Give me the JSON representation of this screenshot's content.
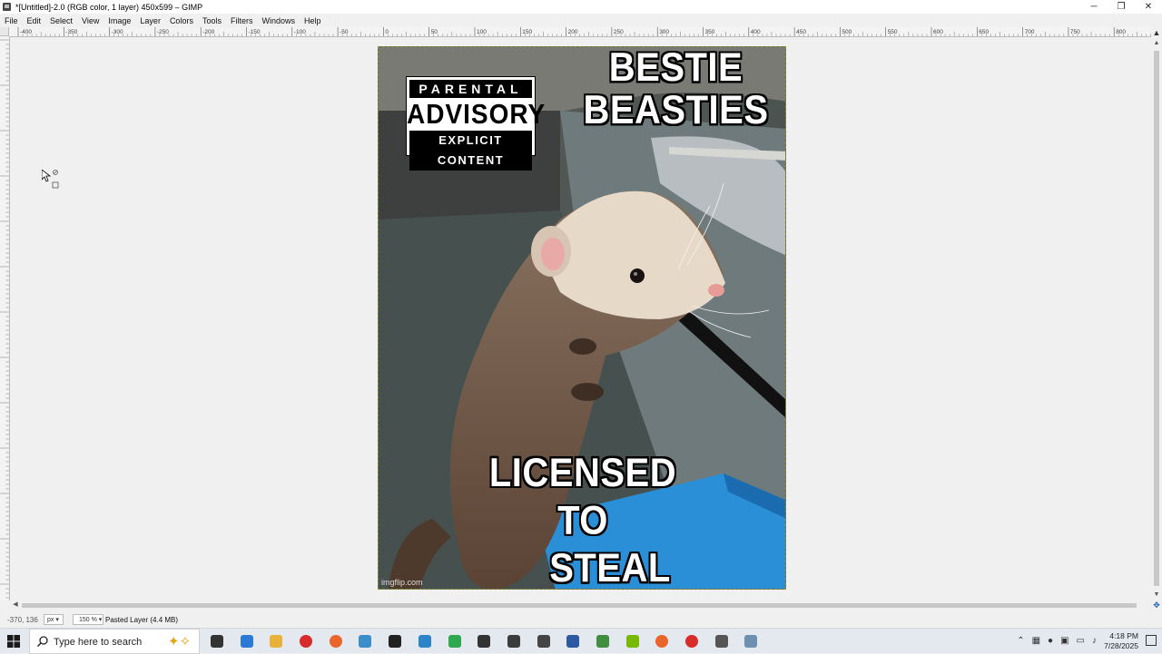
{
  "window": {
    "title": "*[Untitled]-2.0 (RGB color, 1 layer) 450x599 – GIMP",
    "controls": [
      "─",
      "❐",
      "✕"
    ]
  },
  "menu": [
    "File",
    "Edit",
    "Select",
    "View",
    "Image",
    "Layer",
    "Colors",
    "Tools",
    "Filters",
    "Windows",
    "Help"
  ],
  "ruler": {
    "top_labels": [
      "-400",
      "-350",
      "-300",
      "-250",
      "-200",
      "-150",
      "-100",
      "-50",
      "0",
      "50",
      "100",
      "150",
      "200",
      "250",
      "300",
      "350",
      "400",
      "450",
      "500",
      "550",
      "600",
      "650",
      "700",
      "750",
      "800"
    ]
  },
  "image": {
    "top_text_line1": "BESTIE",
    "top_text_line2": "BEASTIES",
    "bottom_text_line1": "LICENSED",
    "bottom_text_line2": "TO",
    "bottom_text_line3": "STEAL",
    "advisory_top": "PARENTAL",
    "advisory_mid": "ADVISORY",
    "advisory_bot": "EXPLICIT CONTENT",
    "watermark": "imgflip.com"
  },
  "status": {
    "coords": "-370, 136",
    "unit": "px",
    "zoom": "150 %",
    "layer_info": "Pasted Layer (4.4 MB)"
  },
  "taskbar": {
    "search_placeholder": "Type here to search",
    "time": "4:18 PM",
    "date": "7/28/2025",
    "icons": [
      "task-view-icon",
      "app-blue-icon",
      "file-explorer-icon",
      "app-red-icon",
      "firefox-icon",
      "app-teal-icon",
      "app-dark-icon",
      "vscode-icon",
      "app-green-icon",
      "app-qr-icon",
      "app-headset-icon",
      "gimp-icon",
      "app-doc-icon",
      "app-sheet-icon",
      "nvidia-icon",
      "firefox-2-icon",
      "app-red-2-icon",
      "settings-icon",
      "app-window-icon"
    ],
    "icon_colors": [
      "#333333",
      "#2b7bd6",
      "#e8b13a",
      "#d82b2b",
      "#e8662a",
      "#3b8ec9",
      "#222222",
      "#2d85c9",
      "#2fa84f",
      "#333333",
      "#3c3c3c",
      "#444444",
      "#2d5aa0",
      "#3f8f3f",
      "#76b900",
      "#e8662a",
      "#d82b2b",
      "#555555",
      "#6e8fb0"
    ]
  },
  "colors": {
    "selection_border": "#8a8a30",
    "canvas_bg": "#f0f0f0"
  }
}
